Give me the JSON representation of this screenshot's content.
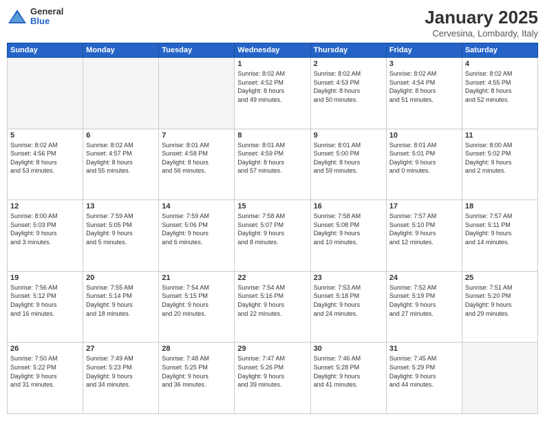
{
  "header": {
    "logo_general": "General",
    "logo_blue": "Blue",
    "month_title": "January 2025",
    "location": "Cervesina, Lombardy, Italy"
  },
  "days_of_week": [
    "Sunday",
    "Monday",
    "Tuesday",
    "Wednesday",
    "Thursday",
    "Friday",
    "Saturday"
  ],
  "rows": [
    [
      {
        "day": "",
        "info": ""
      },
      {
        "day": "",
        "info": ""
      },
      {
        "day": "",
        "info": ""
      },
      {
        "day": "1",
        "info": "Sunrise: 8:02 AM\nSunset: 4:52 PM\nDaylight: 8 hours\nand 49 minutes."
      },
      {
        "day": "2",
        "info": "Sunrise: 8:02 AM\nSunset: 4:53 PM\nDaylight: 8 hours\nand 50 minutes."
      },
      {
        "day": "3",
        "info": "Sunrise: 8:02 AM\nSunset: 4:54 PM\nDaylight: 8 hours\nand 51 minutes."
      },
      {
        "day": "4",
        "info": "Sunrise: 8:02 AM\nSunset: 4:55 PM\nDaylight: 8 hours\nand 52 minutes."
      }
    ],
    [
      {
        "day": "5",
        "info": "Sunrise: 8:02 AM\nSunset: 4:56 PM\nDaylight: 8 hours\nand 53 minutes."
      },
      {
        "day": "6",
        "info": "Sunrise: 8:02 AM\nSunset: 4:57 PM\nDaylight: 8 hours\nand 55 minutes."
      },
      {
        "day": "7",
        "info": "Sunrise: 8:01 AM\nSunset: 4:58 PM\nDaylight: 8 hours\nand 56 minutes."
      },
      {
        "day": "8",
        "info": "Sunrise: 8:01 AM\nSunset: 4:59 PM\nDaylight: 8 hours\nand 57 minutes."
      },
      {
        "day": "9",
        "info": "Sunrise: 8:01 AM\nSunset: 5:00 PM\nDaylight: 8 hours\nand 59 minutes."
      },
      {
        "day": "10",
        "info": "Sunrise: 8:01 AM\nSunset: 5:01 PM\nDaylight: 9 hours\nand 0 minutes."
      },
      {
        "day": "11",
        "info": "Sunrise: 8:00 AM\nSunset: 5:02 PM\nDaylight: 9 hours\nand 2 minutes."
      }
    ],
    [
      {
        "day": "12",
        "info": "Sunrise: 8:00 AM\nSunset: 5:03 PM\nDaylight: 9 hours\nand 3 minutes."
      },
      {
        "day": "13",
        "info": "Sunrise: 7:59 AM\nSunset: 5:05 PM\nDaylight: 9 hours\nand 5 minutes."
      },
      {
        "day": "14",
        "info": "Sunrise: 7:59 AM\nSunset: 5:06 PM\nDaylight: 9 hours\nand 6 minutes."
      },
      {
        "day": "15",
        "info": "Sunrise: 7:58 AM\nSunset: 5:07 PM\nDaylight: 9 hours\nand 8 minutes."
      },
      {
        "day": "16",
        "info": "Sunrise: 7:58 AM\nSunset: 5:08 PM\nDaylight: 9 hours\nand 10 minutes."
      },
      {
        "day": "17",
        "info": "Sunrise: 7:57 AM\nSunset: 5:10 PM\nDaylight: 9 hours\nand 12 minutes."
      },
      {
        "day": "18",
        "info": "Sunrise: 7:57 AM\nSunset: 5:11 PM\nDaylight: 9 hours\nand 14 minutes."
      }
    ],
    [
      {
        "day": "19",
        "info": "Sunrise: 7:56 AM\nSunset: 5:12 PM\nDaylight: 9 hours\nand 16 minutes."
      },
      {
        "day": "20",
        "info": "Sunrise: 7:55 AM\nSunset: 5:14 PM\nDaylight: 9 hours\nand 18 minutes."
      },
      {
        "day": "21",
        "info": "Sunrise: 7:54 AM\nSunset: 5:15 PM\nDaylight: 9 hours\nand 20 minutes."
      },
      {
        "day": "22",
        "info": "Sunrise: 7:54 AM\nSunset: 5:16 PM\nDaylight: 9 hours\nand 22 minutes."
      },
      {
        "day": "23",
        "info": "Sunrise: 7:53 AM\nSunset: 5:18 PM\nDaylight: 9 hours\nand 24 minutes."
      },
      {
        "day": "24",
        "info": "Sunrise: 7:52 AM\nSunset: 5:19 PM\nDaylight: 9 hours\nand 27 minutes."
      },
      {
        "day": "25",
        "info": "Sunrise: 7:51 AM\nSunset: 5:20 PM\nDaylight: 9 hours\nand 29 minutes."
      }
    ],
    [
      {
        "day": "26",
        "info": "Sunrise: 7:50 AM\nSunset: 5:22 PM\nDaylight: 9 hours\nand 31 minutes."
      },
      {
        "day": "27",
        "info": "Sunrise: 7:49 AM\nSunset: 5:23 PM\nDaylight: 9 hours\nand 34 minutes."
      },
      {
        "day": "28",
        "info": "Sunrise: 7:48 AM\nSunset: 5:25 PM\nDaylight: 9 hours\nand 36 minutes."
      },
      {
        "day": "29",
        "info": "Sunrise: 7:47 AM\nSunset: 5:26 PM\nDaylight: 9 hours\nand 39 minutes."
      },
      {
        "day": "30",
        "info": "Sunrise: 7:46 AM\nSunset: 5:28 PM\nDaylight: 9 hours\nand 41 minutes."
      },
      {
        "day": "31",
        "info": "Sunrise: 7:45 AM\nSunset: 5:29 PM\nDaylight: 9 hours\nand 44 minutes."
      },
      {
        "day": "",
        "info": ""
      }
    ]
  ]
}
